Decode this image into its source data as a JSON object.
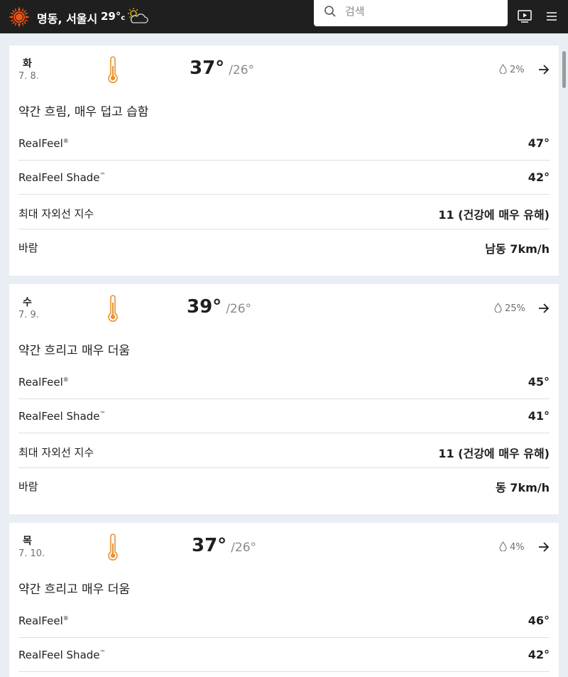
{
  "header": {
    "location": "명동, 서울시",
    "current_temp": "29°",
    "current_unit": "c",
    "current_icon": "partly-cloudy-icon",
    "search_placeholder": "검색"
  },
  "days": [
    {
      "dow": "화",
      "date": "7. 8.",
      "hi": "37°",
      "lo": "/26°",
      "precip": "2%",
      "phrase": "약간 흐림, 매우 덥고 습함",
      "realfeel_label": "RealFeel",
      "realfeel_mark": "®",
      "realfeel": "47°",
      "shade_label": "RealFeel Shade",
      "shade_mark": "™",
      "shade": "42°",
      "uv_label": "최대 자외선 지수",
      "uv": "11 (건강에 매우 유해)",
      "wind_label": "바람",
      "wind": "남동 7km/h"
    },
    {
      "dow": "수",
      "date": "7. 9.",
      "hi": "39°",
      "lo": "/26°",
      "precip": "25%",
      "phrase": "약간 흐리고 매우 더움",
      "realfeel_label": "RealFeel",
      "realfeel_mark": "®",
      "realfeel": "45°",
      "shade_label": "RealFeel Shade",
      "shade_mark": "™",
      "shade": "41°",
      "uv_label": "최대 자외선 지수",
      "uv": "11 (건강에 매우 유해)",
      "wind_label": "바람",
      "wind": "동 7km/h"
    },
    {
      "dow": "목",
      "date": "7. 10.",
      "hi": "37°",
      "lo": "/26°",
      "precip": "4%",
      "phrase": "약간 흐리고 매우 더움",
      "realfeel_label": "RealFeel",
      "realfeel_mark": "®",
      "realfeel": "46°",
      "shade_label": "RealFeel Shade",
      "shade_mark": "™",
      "shade": "42°"
    }
  ],
  "colors": {
    "topbar": "#1f1f1f",
    "sun": "#f05514",
    "thermometer": "#e8922e",
    "background": "#e8eef4"
  }
}
